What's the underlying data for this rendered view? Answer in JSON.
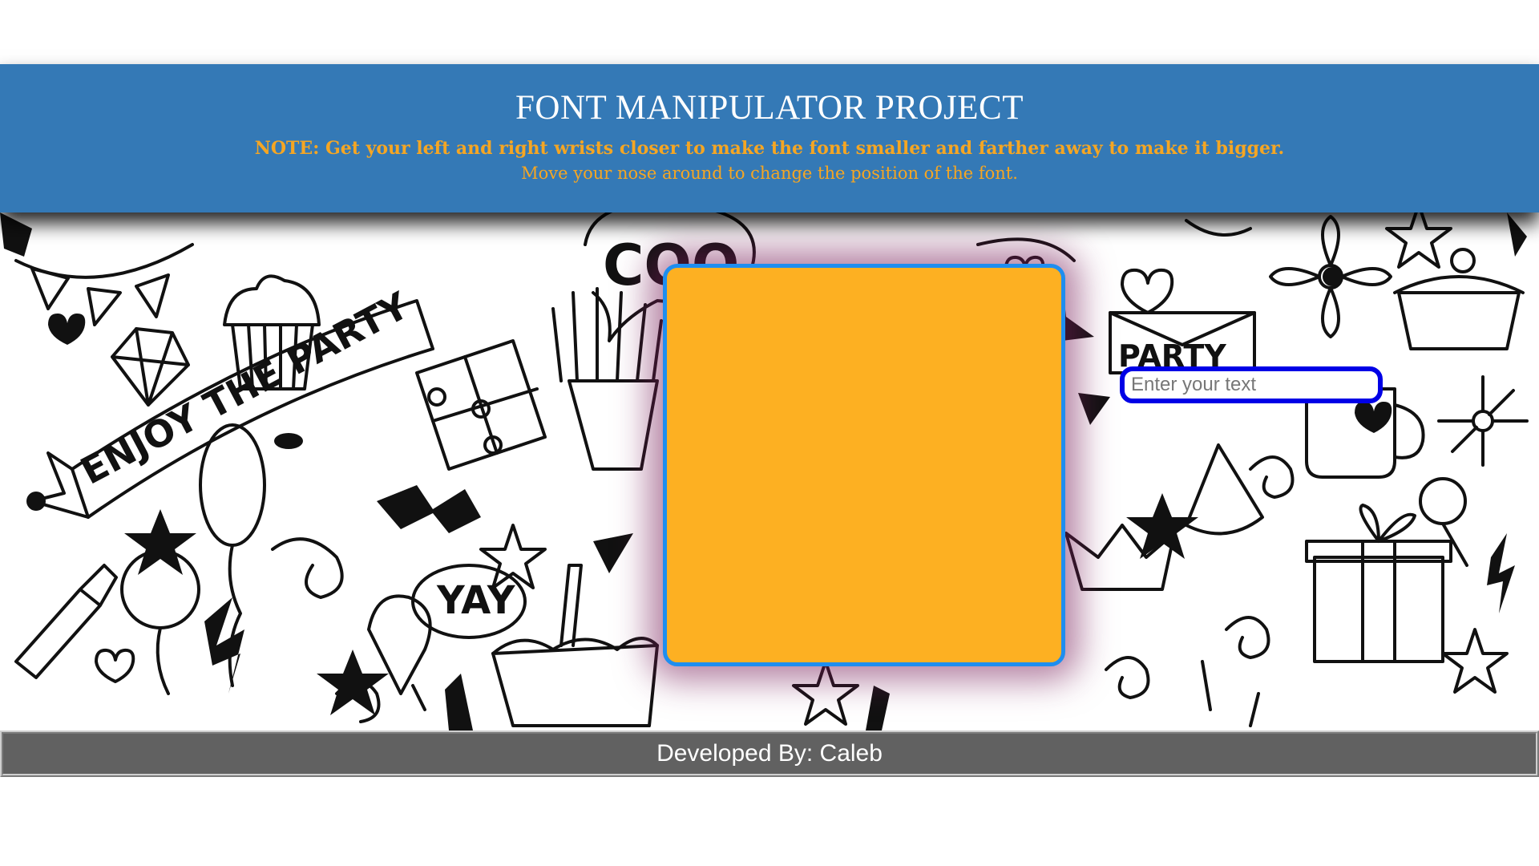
{
  "header": {
    "title": "FONT MANIPULATOR PROJECT",
    "note": "NOTE: Get your left and right wrists closer to make the font smaller and farther away to make it bigger.",
    "note_sub": "Move your nose around to change the position of the font.",
    "background_color": "#3479b6",
    "note_color": "#f5a623"
  },
  "background": {
    "doodle_texts": [
      "ENJOY THE PARTY",
      "YAY",
      "COO",
      "PARTY"
    ],
    "icons": [
      "heart-icon",
      "star-icon",
      "cupcake-icon",
      "gift-icon",
      "balloon-icon",
      "cake-icon",
      "diamond-icon",
      "fries-icon",
      "flower-icon",
      "mug-icon",
      "pizza-icon",
      "envelope-icon",
      "crown-icon",
      "lollipop-icon",
      "candy-icon",
      "bottle-icon",
      "icecream-icon"
    ]
  },
  "canvas": {
    "fill_color": "#fdb022",
    "border_color": "#1e8ef0"
  },
  "text_input": {
    "placeholder": "Enter your text",
    "value": "",
    "border_color": "#0000e6"
  },
  "footer": {
    "text": "Developed By: Caleb",
    "background_color": "#616161"
  }
}
